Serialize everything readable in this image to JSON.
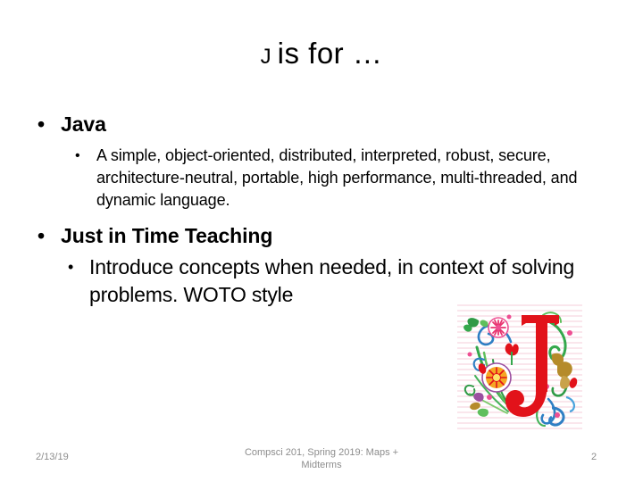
{
  "slide": {
    "background_color": "#ffffff",
    "text_color": "#000000",
    "title": {
      "drop_cap": "J",
      "rest": "is for …"
    },
    "bullets": [
      {
        "level": 1,
        "bullet_glyph": "•",
        "text": "Java",
        "bold": true
      },
      {
        "level": 2,
        "bullet_glyph": "•",
        "text": "A simple, object-oriented, distributed, interpreted, robust, secure, architecture-neutral, portable, high performance, multi-threaded, and dynamic language.",
        "bold": false
      },
      {
        "level": 1,
        "bullet_glyph": "•",
        "text": "Just in Time Teaching",
        "bold": true
      },
      {
        "level": 2,
        "bullet_glyph": "•",
        "text": "Introduce concepts when needed, in context of solving problems. WOTO style",
        "bold": false
      }
    ],
    "graphic": {
      "name": "illuminated-letter-j",
      "letter": "J",
      "letter_color": "#e2121a",
      "colors": {
        "red": "#e2121a",
        "green": "#2fa84f",
        "blue": "#2f7fc4",
        "gold": "#b58b2a",
        "pink": "#ee4f93",
        "orange": "#f08a2c",
        "purple": "#9b4fa0",
        "paper": "#ffffff",
        "rule_line": "#f2c7d4"
      }
    },
    "footer": {
      "date": "2/13/19",
      "center_line1": "Compsci 201, Spring 2019:  Maps +",
      "center_line2": "Midterms",
      "page_number": "2",
      "color": "#8d8d8d"
    }
  }
}
